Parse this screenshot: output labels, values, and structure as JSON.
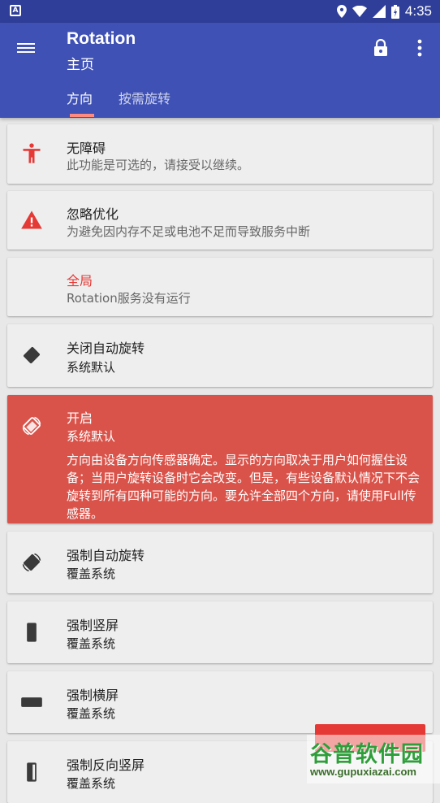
{
  "status_bar": {
    "time": "4:35"
  },
  "app_bar": {
    "title": "Rotation",
    "subtitle": "主页",
    "tabs": [
      {
        "label": "方向",
        "selected": true
      },
      {
        "label": "按需旋转",
        "selected": false
      }
    ]
  },
  "cards": [
    {
      "title": "无障碍",
      "subtitle": "此功能是可选的，请接受以继续。",
      "icon": "accessibility-icon"
    },
    {
      "title": "忽略优化",
      "subtitle": "为避免因内存不足或电池不足而导致服务中断",
      "icon": "warning-icon"
    },
    {
      "title": "全局",
      "subtitle": "Rotation服务没有运行",
      "icon": ""
    },
    {
      "title": "关闭自动旋转",
      "subtitle": "系统默认",
      "icon": "rotation-lock-icon"
    },
    {
      "title": "开启",
      "subtitle": "系统默认",
      "description": "方向由设备方向传感器确定。显示的方向取决于用户如何握住设备；当用户旋转设备时它会改变。但是，有些设备默认情况下不会旋转到所有四种可能的方向。要允许全部四个方向，请使用Full传感器。",
      "icon": "auto-rotate-icon",
      "active": true
    },
    {
      "title": "强制自动旋转",
      "subtitle": "覆盖系统",
      "icon": "force-rotate-icon"
    },
    {
      "title": "强制竖屏",
      "subtitle": "覆盖系统",
      "icon": "portrait-icon"
    },
    {
      "title": "强制横屏",
      "subtitle": "覆盖系统",
      "icon": "landscape-icon"
    },
    {
      "title": "强制反向竖屏",
      "subtitle": "覆盖系统",
      "icon": "reverse-portrait-icon"
    }
  ],
  "watermark": {
    "main": "谷普软件园",
    "url": "www.gupuxiazai.com"
  },
  "colors": {
    "status_bar": "#2f3f99",
    "app_bar": "#3f51b5",
    "accent": "#e53935",
    "active_card": "#d9534a",
    "tab_indicator": "#ff8a80"
  }
}
